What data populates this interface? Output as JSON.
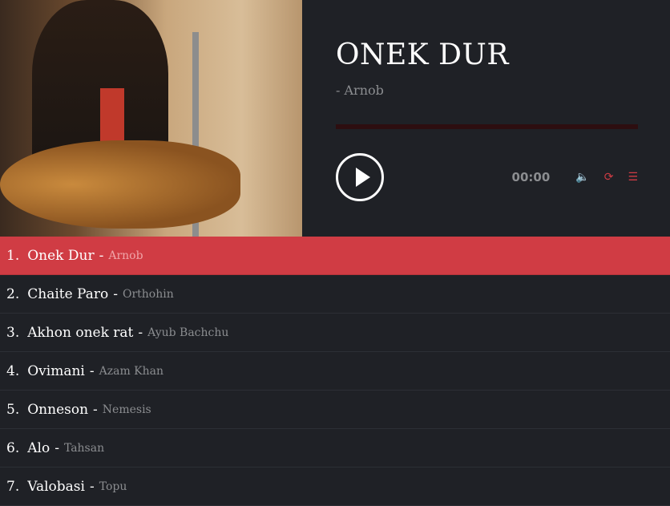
{
  "player": {
    "title": "ONEK DUR",
    "artist": "- Arnob",
    "time": "00:00",
    "progress": 0,
    "icons": [
      "volume-icon",
      "repeat-icon",
      "playlist-icon"
    ]
  },
  "colors": {
    "accent": "#d03c44",
    "background": "#1f2126"
  },
  "playlist": [
    {
      "num": "1.",
      "title": "Onek Dur",
      "artist": "Arnob"
    },
    {
      "num": "2.",
      "title": "Chaite Paro",
      "artist": "Orthohin"
    },
    {
      "num": "3.",
      "title": "Akhon onek rat",
      "artist": "Ayub Bachchu"
    },
    {
      "num": "4.",
      "title": "Ovimani",
      "artist": "Azam Khan"
    },
    {
      "num": "5.",
      "title": "Onneson",
      "artist": "Nemesis"
    },
    {
      "num": "6.",
      "title": "Alo",
      "artist": "Tahsan"
    },
    {
      "num": "7.",
      "title": "Valobasi",
      "artist": "Topu"
    }
  ]
}
